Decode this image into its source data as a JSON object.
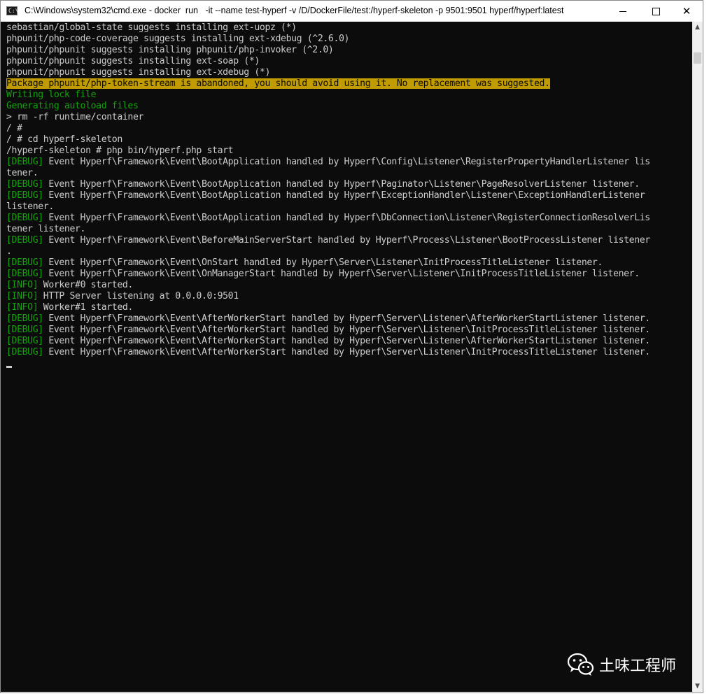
{
  "window": {
    "title": "C:\\Windows\\system32\\cmd.exe - docker  run   -it --name test-hyperf -v /D/DockerFile/test:/hyperf-skeleton -p 9501:9501 hyperf/hyperf:latest",
    "app_icon_text": "C:\\",
    "controls": {
      "minimize": "minimize-icon",
      "maximize": "maximize-icon",
      "close": "✕"
    }
  },
  "console": {
    "lines": [
      {
        "type": "plain",
        "text": "sebastian/global-state suggests installing ext-uopz (*)"
      },
      {
        "type": "plain",
        "text": "phpunit/php-code-coverage suggests installing ext-xdebug (^2.6.0)"
      },
      {
        "type": "plain",
        "text": "phpunit/phpunit suggests installing phpunit/php-invoker (^2.0)"
      },
      {
        "type": "plain",
        "text": "phpunit/phpunit suggests installing ext-soap (*)"
      },
      {
        "type": "plain",
        "text": "phpunit/phpunit suggests installing ext-xdebug (*)"
      },
      {
        "type": "warn",
        "text": "Package phpunit/php-token-stream is abandoned, you should avoid using it. No replacement was suggested."
      },
      {
        "type": "green",
        "text": "Writing lock file"
      },
      {
        "type": "green",
        "text": "Generating autoload files"
      },
      {
        "type": "plain",
        "text": "> rm -rf runtime/container"
      },
      {
        "type": "plain",
        "text": "/ #"
      },
      {
        "type": "plain",
        "text": "/ # cd hyperf-skeleton"
      },
      {
        "type": "plain",
        "text": "/hyperf-skeleton # php bin/hyperf.php start"
      },
      {
        "type": "log",
        "tag": "[DEBUG]",
        "text": " Event Hyperf\\Framework\\Event\\BootApplication handled by Hyperf\\Config\\Listener\\RegisterPropertyHandlerListener lis"
      },
      {
        "type": "plain",
        "text": "tener."
      },
      {
        "type": "log",
        "tag": "[DEBUG]",
        "text": " Event Hyperf\\Framework\\Event\\BootApplication handled by Hyperf\\Paginator\\Listener\\PageResolverListener listener."
      },
      {
        "type": "log",
        "tag": "[DEBUG]",
        "text": " Event Hyperf\\Framework\\Event\\BootApplication handled by Hyperf\\ExceptionHandler\\Listener\\ExceptionHandlerListener"
      },
      {
        "type": "plain",
        "text": "listener."
      },
      {
        "type": "log",
        "tag": "[DEBUG]",
        "text": " Event Hyperf\\Framework\\Event\\BootApplication handled by Hyperf\\DbConnection\\Listener\\RegisterConnectionResolverLis"
      },
      {
        "type": "plain",
        "text": "tener listener."
      },
      {
        "type": "log",
        "tag": "[DEBUG]",
        "text": " Event Hyperf\\Framework\\Event\\BeforeMainServerStart handled by Hyperf\\Process\\Listener\\BootProcessListener listener"
      },
      {
        "type": "plain",
        "text": "."
      },
      {
        "type": "log",
        "tag": "[DEBUG]",
        "text": " Event Hyperf\\Framework\\Event\\OnStart handled by Hyperf\\Server\\Listener\\InitProcessTitleListener listener."
      },
      {
        "type": "log",
        "tag": "[DEBUG]",
        "text": " Event Hyperf\\Framework\\Event\\OnManagerStart handled by Hyperf\\Server\\Listener\\InitProcessTitleListener listener."
      },
      {
        "type": "log",
        "tag": "[INFO]",
        "text": " Worker#0 started."
      },
      {
        "type": "log",
        "tag": "[INFO]",
        "text": " HTTP Server listening at 0.0.0.0:9501"
      },
      {
        "type": "log",
        "tag": "[INFO]",
        "text": " Worker#1 started."
      },
      {
        "type": "log",
        "tag": "[DEBUG]",
        "text": " Event Hyperf\\Framework\\Event\\AfterWorkerStart handled by Hyperf\\Server\\Listener\\AfterWorkerStartListener listener."
      },
      {
        "type": "log",
        "tag": "[DEBUG]",
        "text": " Event Hyperf\\Framework\\Event\\AfterWorkerStart handled by Hyperf\\Server\\Listener\\InitProcessTitleListener listener."
      },
      {
        "type": "log",
        "tag": "[DEBUG]",
        "text": " Event Hyperf\\Framework\\Event\\AfterWorkerStart handled by Hyperf\\Server\\Listener\\AfterWorkerStartListener listener."
      },
      {
        "type": "log",
        "tag": "[DEBUG]",
        "text": " Event Hyperf\\Framework\\Event\\AfterWorkerStart handled by Hyperf\\Server\\Listener\\InitProcessTitleListener listener."
      }
    ]
  },
  "scrollbar": {
    "up": "▲",
    "down": "▼"
  },
  "watermark": {
    "text": "土味工程师",
    "icon": "wechat-icon"
  },
  "colors": {
    "console_bg": "#0c0c0c",
    "text": "#cccccc",
    "green": "#13a10e",
    "warn_bg": "#c19c00"
  }
}
